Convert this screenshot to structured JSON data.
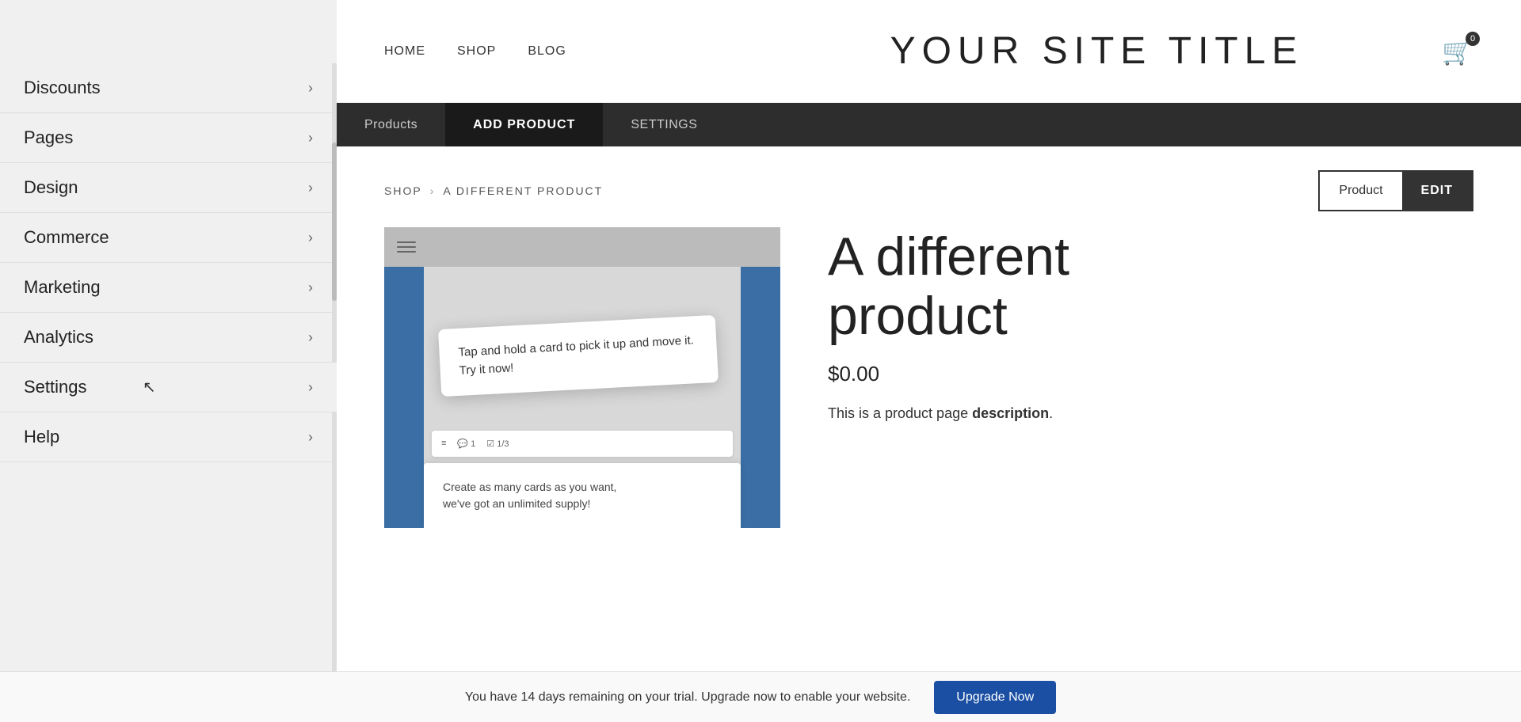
{
  "sidebar": {
    "items": [
      {
        "id": "discounts",
        "label": "Discounts"
      },
      {
        "id": "pages",
        "label": "Pages"
      },
      {
        "id": "design",
        "label": "Design"
      },
      {
        "id": "commerce",
        "label": "Commerce"
      },
      {
        "id": "marketing",
        "label": "Marketing"
      },
      {
        "id": "analytics",
        "label": "Analytics"
      },
      {
        "id": "settings",
        "label": "Settings"
      },
      {
        "id": "help",
        "label": "Help"
      }
    ]
  },
  "topnav": {
    "links": [
      {
        "label": "HOME"
      },
      {
        "label": "SHOP"
      },
      {
        "label": "BLOG"
      }
    ],
    "site_title": "YOUR SITE TITLE",
    "cart_count": "0"
  },
  "admin_tabs": [
    {
      "id": "products",
      "label": "Products",
      "active": false
    },
    {
      "id": "add_product",
      "label": "ADD PRODUCT",
      "active": true
    },
    {
      "id": "settings",
      "label": "SETTINGS",
      "active": false
    }
  ],
  "breadcrumb": {
    "shop": "SHOP",
    "separator": "›",
    "current": "A DIFFERENT PRODUCT"
  },
  "edit_button": {
    "product_label": "Product",
    "edit_label": "EDIT"
  },
  "product": {
    "title_line1": "A different",
    "title_line2": "product",
    "price": "$0.00",
    "description_prefix": "This is a product page ",
    "description_bold": "description",
    "description_suffix": "."
  },
  "mockup": {
    "tooltip_text": "Tap and hold a card to pick it up and move it. Try it now!",
    "bottom_card_line1": "Create as many cards as you want,",
    "bottom_card_line2": "we've got an unlimited supply!"
  },
  "upgrade_banner": {
    "text": "You have 14 days remaining on your trial. Upgrade now to enable your website.",
    "button_label": "Upgrade Now"
  }
}
